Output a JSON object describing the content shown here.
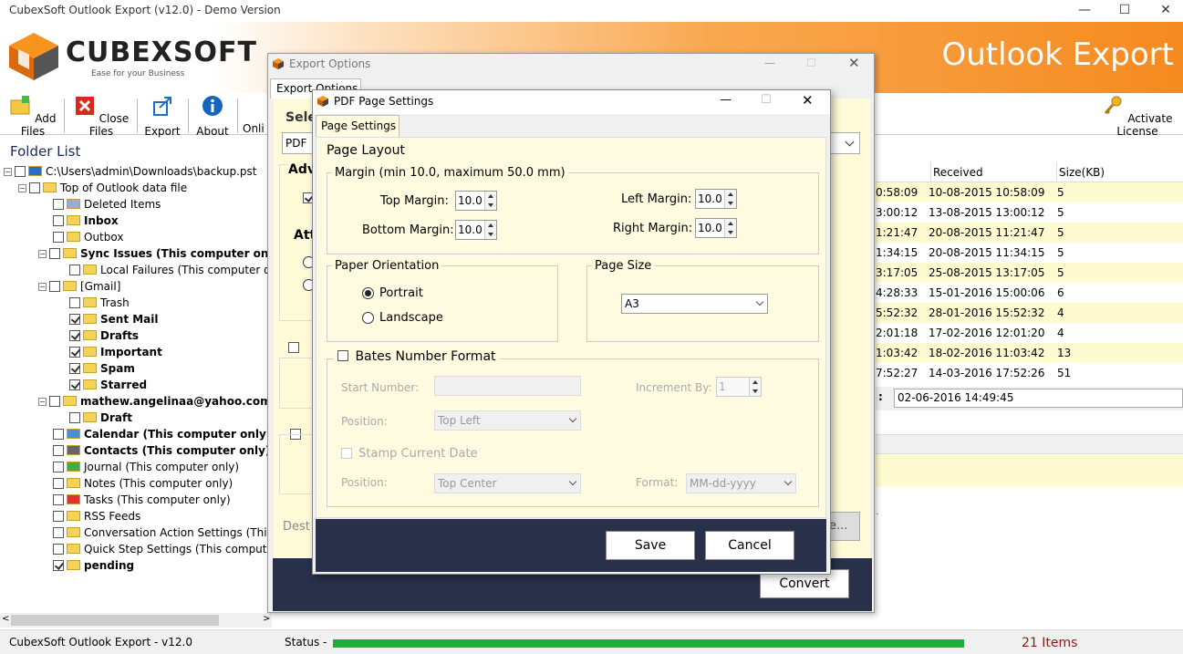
{
  "app": {
    "title": "CubexSoft Outlook Export  (v12.0) - Demo Version",
    "logo_main": "CUBEXSOFT",
    "logo_tag": "Ease for your Business",
    "banner": "Outlook Export"
  },
  "toolbar": {
    "add_files": "Add Files",
    "close_files": "Close Files",
    "export": "Export",
    "about": "About",
    "online": "Onli",
    "activate": "Activate License"
  },
  "folders": {
    "heading": "Folder List",
    "items": [
      "C:\\Users\\admin\\Downloads\\backup.pst",
      "Top of Outlook data file",
      "Deleted Items",
      "Inbox",
      "Outbox",
      "Sync Issues (This computer only)",
      "Local Failures (This computer only)",
      "[Gmail]",
      "Trash",
      "Sent Mail",
      "Drafts",
      "Important",
      "Spam",
      "Starred",
      "mathew.angelinaa@yahoo.com",
      "Draft",
      "Calendar (This computer only)",
      "Contacts (This computer only)",
      "Journal (This computer only)",
      "Notes (This computer only)",
      "Tasks (This computer only)",
      "RSS Feeds",
      "Conversation Action Settings (This con",
      "Quick Step Settings (This computer on",
      "pending"
    ]
  },
  "grid": {
    "col_received": "Received",
    "col_size": "Size(KB)",
    "rows": [
      {
        "t": "0:58:09",
        "r": "10-08-2015 10:58:09",
        "s": "5"
      },
      {
        "t": "3:00:12",
        "r": "13-08-2015 13:00:12",
        "s": "5"
      },
      {
        "t": "1:21:47",
        "r": "20-08-2015 11:21:47",
        "s": "5"
      },
      {
        "t": "1:34:15",
        "r": "20-08-2015 11:34:15",
        "s": "5"
      },
      {
        "t": "3:17:05",
        "r": "25-08-2015 13:17:05",
        "s": "5"
      },
      {
        "t": "4:28:33",
        "r": "15-01-2016 15:00:06",
        "s": "6"
      },
      {
        "t": "5:52:32",
        "r": "28-01-2016 15:52:32",
        "s": "4"
      },
      {
        "t": "2:01:18",
        "r": "17-02-2016 12:01:20",
        "s": "4"
      },
      {
        "t": "1:03:42",
        "r": "18-02-2016 11:03:42",
        "s": "13"
      },
      {
        "t": "7:52:27",
        "r": "14-03-2016 17:52:26",
        "s": "51"
      }
    ],
    "detail_value": "02-06-2016 14:49:45"
  },
  "export_options": {
    "title": "Export Options",
    "tab": "Export Options",
    "select_label": "Sele",
    "format": "PDF",
    "adv": "Adv",
    "att": "Att",
    "dest": "Dest",
    "browse": "e...",
    "convert": "Convert"
  },
  "pdf": {
    "title": "PDF Page Settings",
    "tab": "Page Settings",
    "layout": "Page Layout",
    "margin_group": "Margin (min 10.0, maximum 50.0 mm)",
    "top_margin": "Top Margin:",
    "top_val": "10.0",
    "bottom_margin": "Bottom Margin:",
    "bottom_val": "10.0",
    "left_margin": "Left Margin:",
    "left_val": "10.0",
    "right_margin": "Right Margin:",
    "right_val": "10.0",
    "orientation": "Paper Orientation",
    "portrait": "Portrait",
    "landscape": "Landscape",
    "page_size_label": "Page Size",
    "page_size": "A3",
    "bates": "Bates Number Format",
    "start_number": "Start Number:",
    "increment": "Increment By:",
    "increment_val": "1",
    "position": "Position:",
    "position_val": "Top Left",
    "stamp": "Stamp Current Date",
    "position2": "Position:",
    "position2_val": "Top Center",
    "format": "Format:",
    "format_val": "MM-dd-yyyy",
    "save": "Save",
    "cancel": "Cancel"
  },
  "status": {
    "footer": "CubexSoft Outlook Export - v12.0",
    "status": "Status -",
    "items": "21 Items",
    "progress": 1.0
  },
  "colors": {
    "accent": "#f58a1f",
    "footer": "#28304a",
    "progress": "#1cae3a"
  }
}
